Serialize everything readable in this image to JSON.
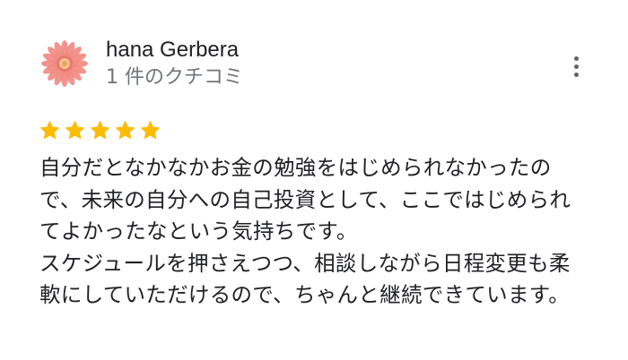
{
  "review": {
    "reviewer_name": "hana Gerbera",
    "review_count": "1 件のクチコミ",
    "rating": 5,
    "max_rating": 5,
    "star_color": "#fbbc04",
    "text_lines": [
      "自分だとなかなかお金の勉強をはじめられなかったの",
      "で、未来の自分への自己投資として、ここではじめられ",
      "てよかったなという気持ちです。",
      "スケジュールを押さえつつ、相談しながら日程変更も柔",
      "軟にしていただけるので、ちゃんと継続できています。"
    ]
  },
  "avatar": {
    "icon": "gerbera-flower-icon",
    "petal_color": "#f28b82",
    "center_color": "#f6c28a"
  },
  "more_menu": {
    "icon": "more-vertical-icon"
  }
}
